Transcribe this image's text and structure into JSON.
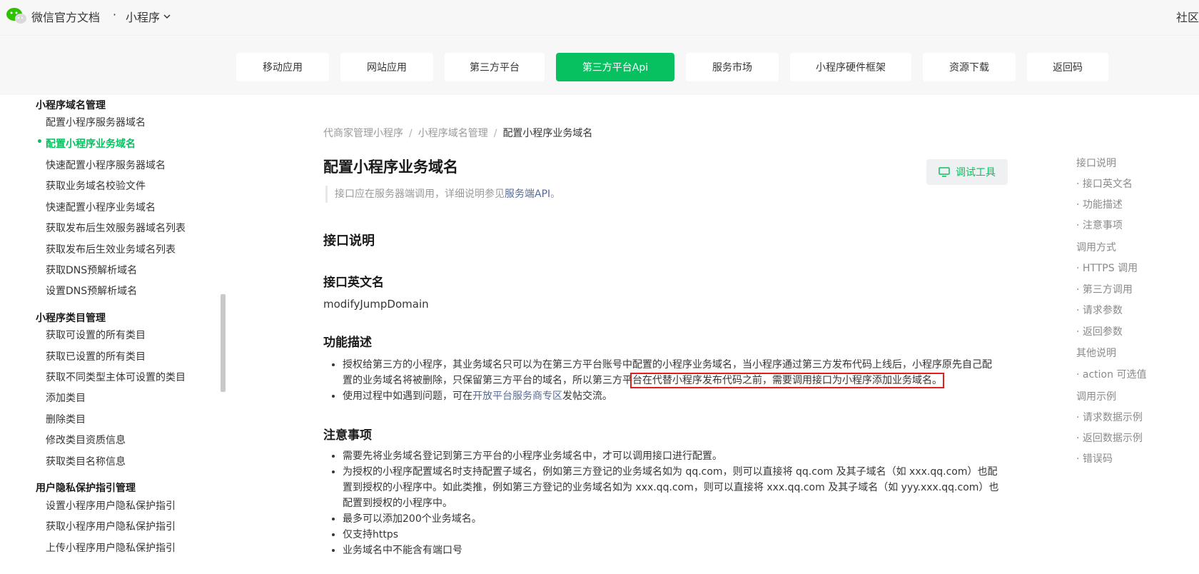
{
  "header": {
    "brand": "微信官方文档",
    "dot": "·",
    "product": "小程序",
    "community": "社区"
  },
  "nav": {
    "tabs": [
      {
        "label": "移动应用",
        "active": false
      },
      {
        "label": "网站应用",
        "active": false
      },
      {
        "label": "第三方平台",
        "active": false
      },
      {
        "label": "第三方平台Api",
        "active": true
      },
      {
        "label": "服务市场",
        "active": false
      },
      {
        "label": "小程序硬件框架",
        "active": false
      },
      {
        "label": "资源下载",
        "active": false
      },
      {
        "label": "返回码",
        "active": false
      }
    ]
  },
  "sidebar": {
    "groups": [
      {
        "title": "小程序域名管理",
        "items": [
          "配置小程序服务器域名",
          "配置小程序业务域名",
          "快速配置小程序服务器域名",
          "获取业务域名校验文件",
          "快速配置小程序业务域名",
          "获取发布后生效服务器域名列表",
          "获取发布后生效业务域名列表",
          "获取DNS预解析域名",
          "设置DNS预解析域名"
        ]
      },
      {
        "title": "小程序类目管理",
        "items": [
          "获取可设置的所有类目",
          "获取已设置的所有类目",
          "获取不同类型主体可设置的类目",
          "添加类目",
          "删除类目",
          "修改类目资质信息",
          "获取类目名称信息"
        ]
      },
      {
        "title": "用户隐私保护指引管理",
        "items": [
          "设置小程序用户隐私保护指引",
          "获取小程序用户隐私保护指引",
          "上传小程序用户隐私保护指引"
        ]
      }
    ],
    "active_item": "配置小程序业务域名"
  },
  "breadcrumb": [
    "代商家管理小程序",
    "小程序域名管理",
    "配置小程序业务域名"
  ],
  "breadcrumb_sep": "/",
  "page": {
    "title": "配置小程序业务域名",
    "debug_button": "调试工具",
    "note_prefix": "接口应在服务器端调用，详细说明参见",
    "note_link": "服务端API",
    "note_suffix": "。"
  },
  "sections": {
    "interface_desc": "接口说明",
    "english_name_title": "接口英文名",
    "english_name": "modifyJumpDomain",
    "function_title": "功能描述",
    "function_items": {
      "item1_prefix": "授权给第三方的小程序，其业务域名只可以为在第三方平台账号中配置的小程序业务域名，当小程序通过第三方发布代码上线后，小程序原先自己配置的业务域名将被删除，只保留第三方平台的域名，所以第三方平",
      "item1_highlight": "台在代替小程序发布代码之前，需要调用接口为小程序添加业务域名。",
      "item2_prefix": "使用过程中如遇到问题，可在",
      "item2_link": "开放平台服务商专区",
      "item2_suffix": "发帖交流。"
    },
    "notes_title": "注意事项",
    "notes": [
      "需要先将业务域名登记到第三方平台的小程序业务域名中，才可以调用接口进行配置。",
      "为授权的小程序配置域名时支持配置子域名，例如第三方登记的业务域名如为 qq.com，则可以直接将 qq.com 及其子域名（如 xxx.qq.com）也配置到授权的小程序中。如此类推，例如第三方登记的业务域名如为 xxx.qq.com，则可以直接将 xxx.qq.com 及其子域名（如 yyy.xxx.qq.com）也配置到授权的小程序中。",
      "最多可以添加200个业务域名。",
      "仅支持https",
      "业务域名中不能含有端口号"
    ]
  },
  "toc": [
    {
      "label": "接口说明",
      "sub": false
    },
    {
      "label": "接口英文名",
      "sub": true
    },
    {
      "label": "功能描述",
      "sub": true
    },
    {
      "label": "注意事项",
      "sub": true
    },
    {
      "label": "调用方式",
      "sub": false
    },
    {
      "label": "HTTPS 调用",
      "sub": true
    },
    {
      "label": "第三方调用",
      "sub": true
    },
    {
      "label": "请求参数",
      "sub": true
    },
    {
      "label": "返回参数",
      "sub": true
    },
    {
      "label": "其他说明",
      "sub": false
    },
    {
      "label": "action 可选值",
      "sub": true
    },
    {
      "label": "调用示例",
      "sub": false
    },
    {
      "label": "请求数据示例",
      "sub": true
    },
    {
      "label": "返回数据示例",
      "sub": true
    },
    {
      "label": "错误码",
      "sub": true
    }
  ],
  "colors": {
    "accent": "#07c160",
    "link": "#576b95",
    "highlight_border": "#e02020"
  },
  "icons": [
    "wechat-logo-icon",
    "chevron-down-icon",
    "monitor-icon"
  ]
}
